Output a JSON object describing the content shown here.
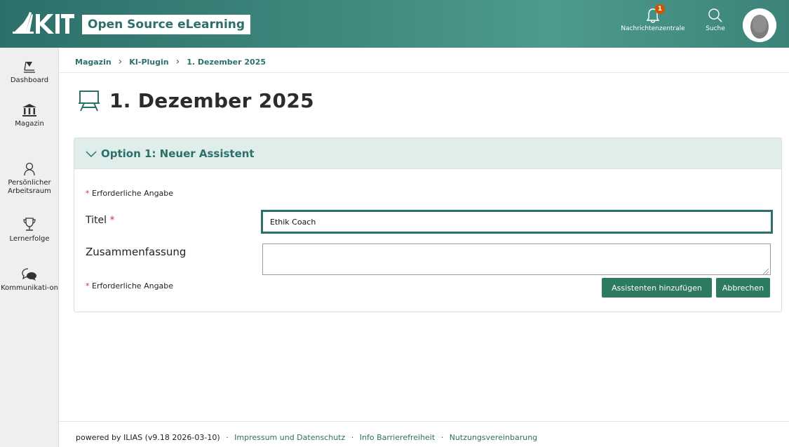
{
  "header": {
    "brand": "Open Source eLearning",
    "notifications_label": "Nachrichtenzentrale",
    "notifications_count": "1",
    "search_label": "Suche"
  },
  "sidebar": {
    "items": [
      {
        "label": "Dashboard",
        "icon": "dashboard-icon"
      },
      {
        "label": "Magazin",
        "icon": "museum-icon"
      },
      {
        "label": "Persönlicher Arbeitsraum",
        "icon": "person-icon"
      },
      {
        "label": "Lernerfolge",
        "icon": "trophy-icon"
      },
      {
        "label": "Kommunikati-on",
        "icon": "chat-icon"
      }
    ]
  },
  "breadcrumb": [
    "Magazin",
    "KI-Plugin",
    "1. Dezember 2025"
  ],
  "page": {
    "title": "1. Dezember 2025"
  },
  "form": {
    "section_title": "Option 1: Neuer Assistent",
    "required_note": "Erforderliche Angabe",
    "title_label": "Titel",
    "title_value": "Ethik Coach",
    "summary_label": "Zusammenfassung",
    "summary_value": "",
    "add_button": "Assistenten hinzufügen",
    "cancel_button": "Abbrechen"
  },
  "footer": {
    "powered": "powered by ILIAS (v9.18 2026-03-10)",
    "links": [
      "Impressum und Datenschutz",
      "Info Barrierefreiheit",
      "Nutzungsvereinbarung"
    ]
  },
  "colors": {
    "accent": "#2d6f69",
    "button": "#2d7a61",
    "panel_head": "#dfeeeb",
    "required": "#c0392b",
    "badge": "#d35400"
  }
}
